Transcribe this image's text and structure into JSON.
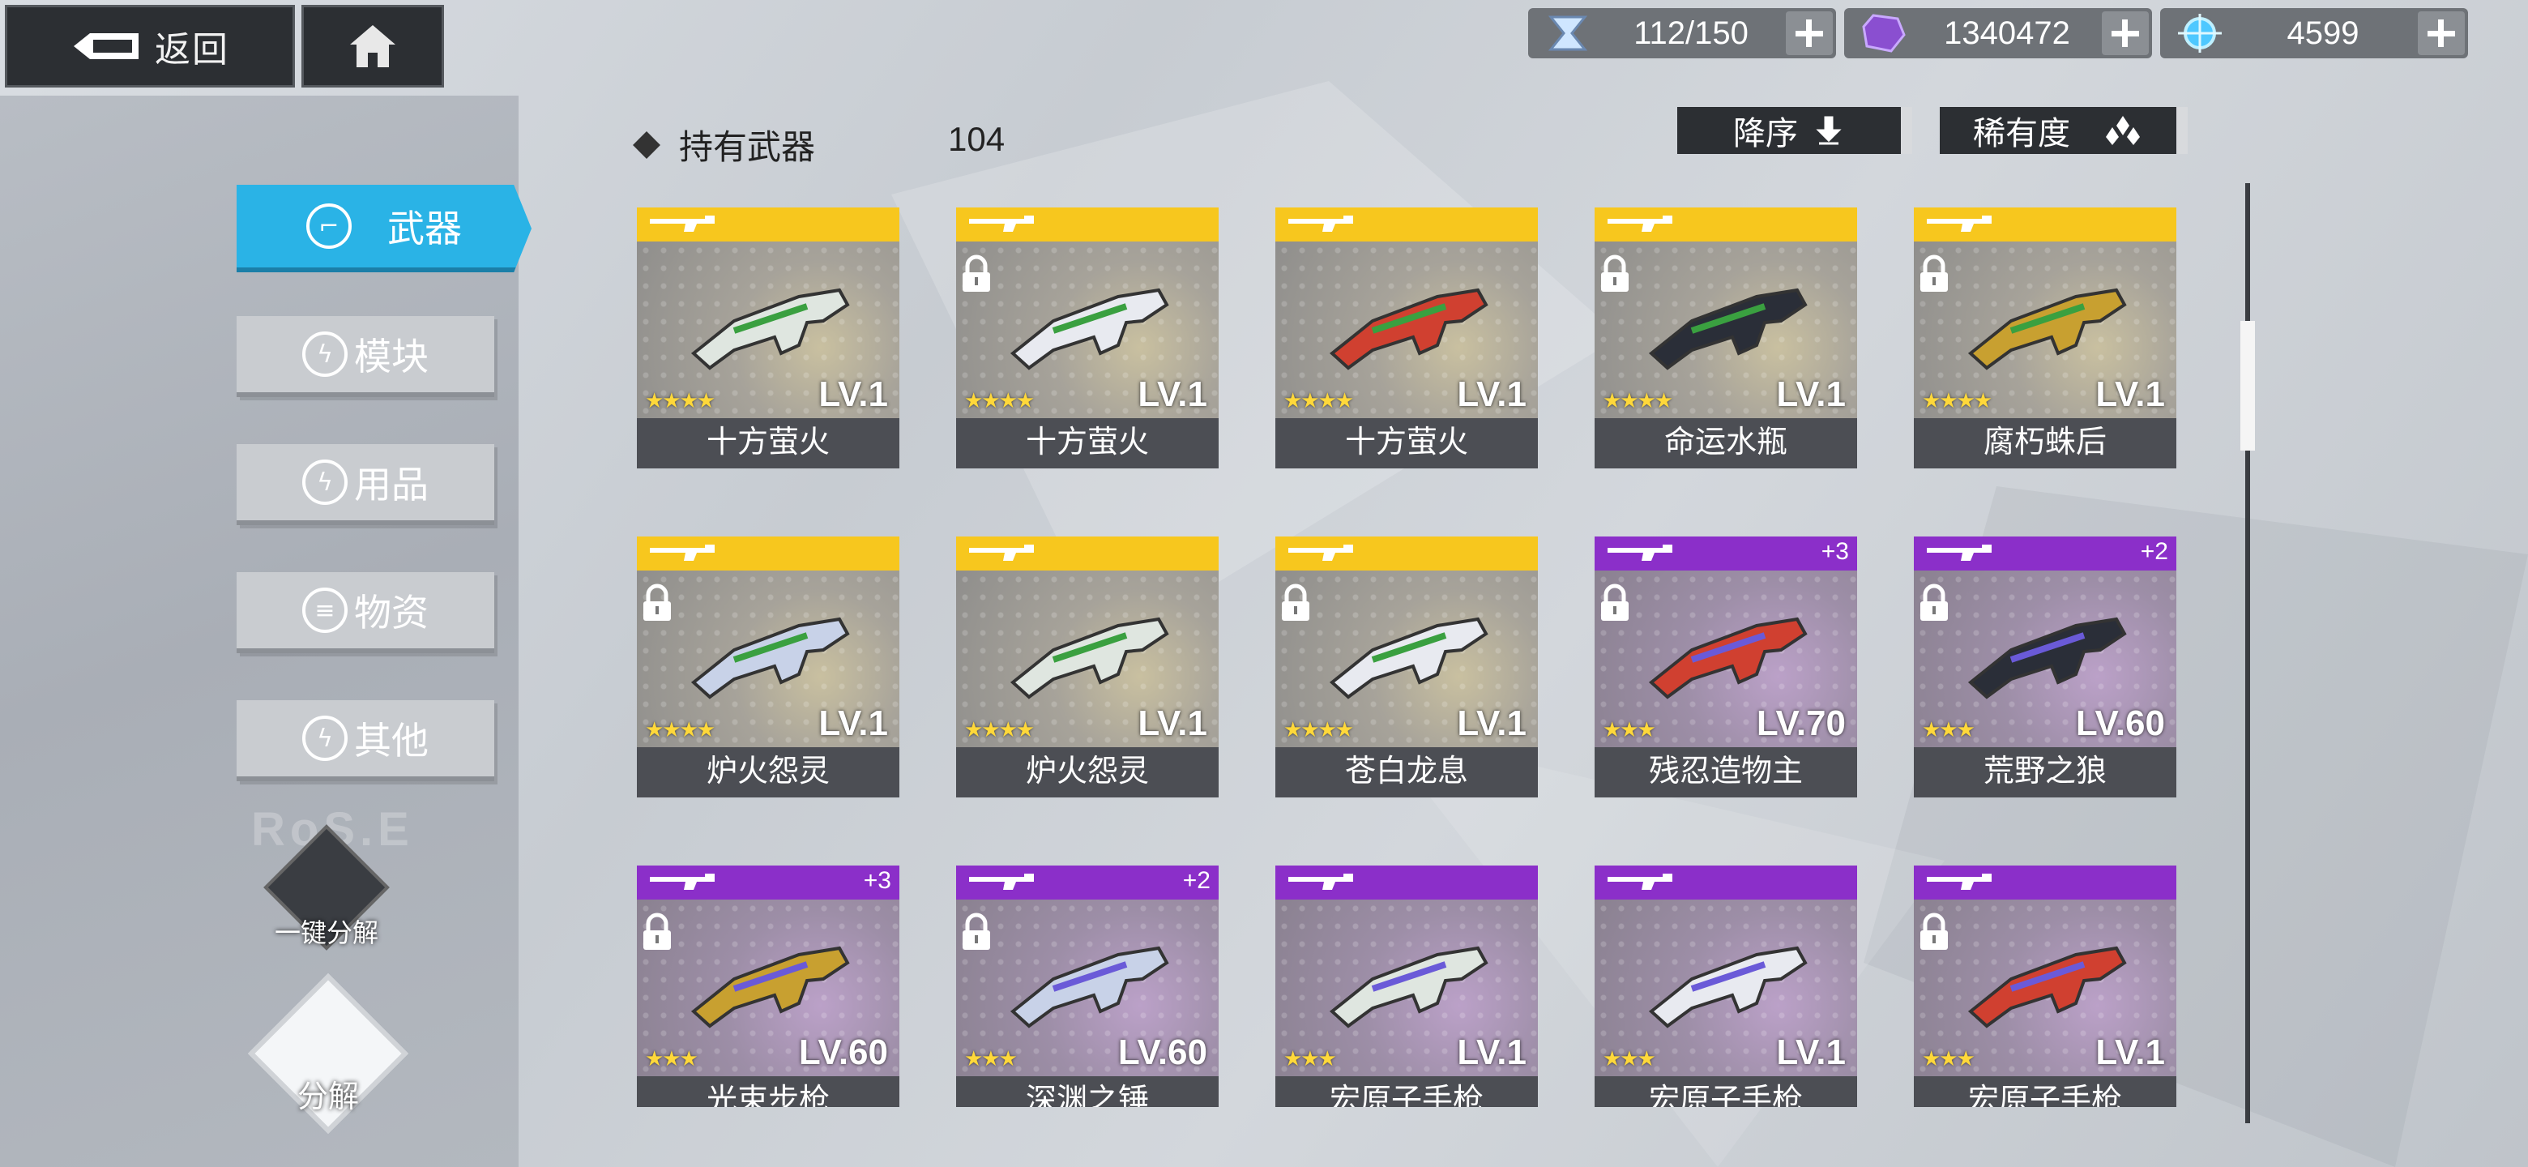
{
  "topbar": {
    "back_label": "返回",
    "resources": [
      {
        "icon": "hourglass-icon",
        "value": "112/150"
      },
      {
        "icon": "purple-crystal-icon",
        "value": "1340472"
      },
      {
        "icon": "blue-orb-icon",
        "value": "4599"
      }
    ]
  },
  "sidebar": {
    "items": [
      {
        "label": "武器",
        "icon": "gun-icon",
        "active": true
      },
      {
        "label": "模块",
        "icon": "bolt-icon",
        "active": false
      },
      {
        "label": "用品",
        "icon": "bolt-icon",
        "active": false
      },
      {
        "label": "物资",
        "icon": "stack-icon",
        "active": false
      },
      {
        "label": "其他",
        "icon": "bolt-icon",
        "active": false
      }
    ],
    "watermark": "RoS.E",
    "quick_dismantle_label": "一键分解",
    "dismantle_label": "分解"
  },
  "header": {
    "title": "持有武器",
    "count": "104",
    "sort_order_label": "降序",
    "sort_rarity_label": "稀有度"
  },
  "weapons": [
    {
      "name": "十方萤火",
      "level": "LV.1",
      "stars": "★★★★",
      "rarity": "gold",
      "locked": false,
      "plus": ""
    },
    {
      "name": "十方萤火",
      "level": "LV.1",
      "stars": "★★★★",
      "rarity": "gold",
      "locked": true,
      "plus": ""
    },
    {
      "name": "十方萤火",
      "level": "LV.1",
      "stars": "★★★★",
      "rarity": "gold",
      "locked": false,
      "plus": ""
    },
    {
      "name": "命运水瓶",
      "level": "LV.1",
      "stars": "★★★★",
      "rarity": "gold",
      "locked": true,
      "plus": ""
    },
    {
      "name": "腐朽蛛后",
      "level": "LV.1",
      "stars": "★★★★",
      "rarity": "gold",
      "locked": true,
      "plus": ""
    },
    {
      "name": "炉火怨灵",
      "level": "LV.1",
      "stars": "★★★★",
      "rarity": "gold",
      "locked": true,
      "plus": ""
    },
    {
      "name": "炉火怨灵",
      "level": "LV.1",
      "stars": "★★★★",
      "rarity": "gold",
      "locked": false,
      "plus": ""
    },
    {
      "name": "苍白龙息",
      "level": "LV.1",
      "stars": "★★★★",
      "rarity": "gold",
      "locked": true,
      "plus": ""
    },
    {
      "name": "残忍造物主",
      "level": "LV.70",
      "stars": "★★★",
      "rarity": "purple",
      "locked": true,
      "plus": "+3"
    },
    {
      "name": "荒野之狼",
      "level": "LV.60",
      "stars": "★★★",
      "rarity": "purple",
      "locked": true,
      "plus": "+2"
    },
    {
      "name": "光束步枪",
      "level": "LV.60",
      "stars": "★★★",
      "rarity": "purple",
      "locked": true,
      "plus": "+3"
    },
    {
      "name": "深渊之锤",
      "level": "LV.60",
      "stars": "★★★",
      "rarity": "purple",
      "locked": true,
      "plus": "+2"
    },
    {
      "name": "宏原子手枪",
      "level": "LV.1",
      "stars": "★★★",
      "rarity": "purple",
      "locked": false,
      "plus": ""
    },
    {
      "name": "宏原子手枪",
      "level": "LV.1",
      "stars": "★★★",
      "rarity": "purple",
      "locked": false,
      "plus": ""
    },
    {
      "name": "宏原子手枪",
      "level": "LV.1",
      "stars": "★★★",
      "rarity": "purple",
      "locked": true,
      "plus": ""
    }
  ],
  "colors": {
    "accent": "#2ab3e6",
    "gold": "#f7c71e",
    "purple": "#8b2fc9",
    "dark": "#2c2f33"
  }
}
